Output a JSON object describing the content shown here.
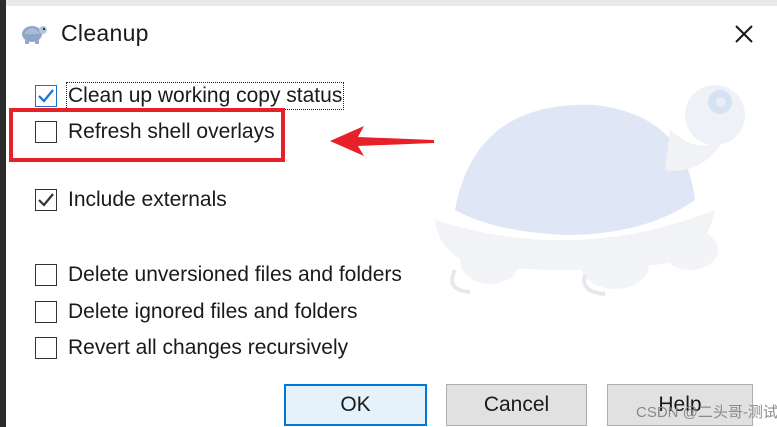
{
  "dialog": {
    "title": "Cleanup",
    "app_icon": "tortoisesvn-turtle-icon",
    "close_icon": "close-icon"
  },
  "options": [
    {
      "label": "Clean up working copy status",
      "checked": true
    },
    {
      "label": "Refresh shell overlays",
      "checked": false
    },
    {
      "label": "Include externals",
      "checked": true
    },
    {
      "label": "Delete unversioned files and folders",
      "checked": false
    },
    {
      "label": "Delete ignored files and folders",
      "checked": false
    },
    {
      "label": "Revert all changes recursively",
      "checked": false
    }
  ],
  "buttons": {
    "ok": "OK",
    "cancel": "Cancel",
    "help": "Help"
  },
  "annotation": {
    "highlight_color": "#e8202a",
    "arrow_color": "#e8202a"
  },
  "credit": "CSDN @二头哥-测试",
  "colors": {
    "accent": "#0078d7",
    "check": "#1e72c8"
  }
}
